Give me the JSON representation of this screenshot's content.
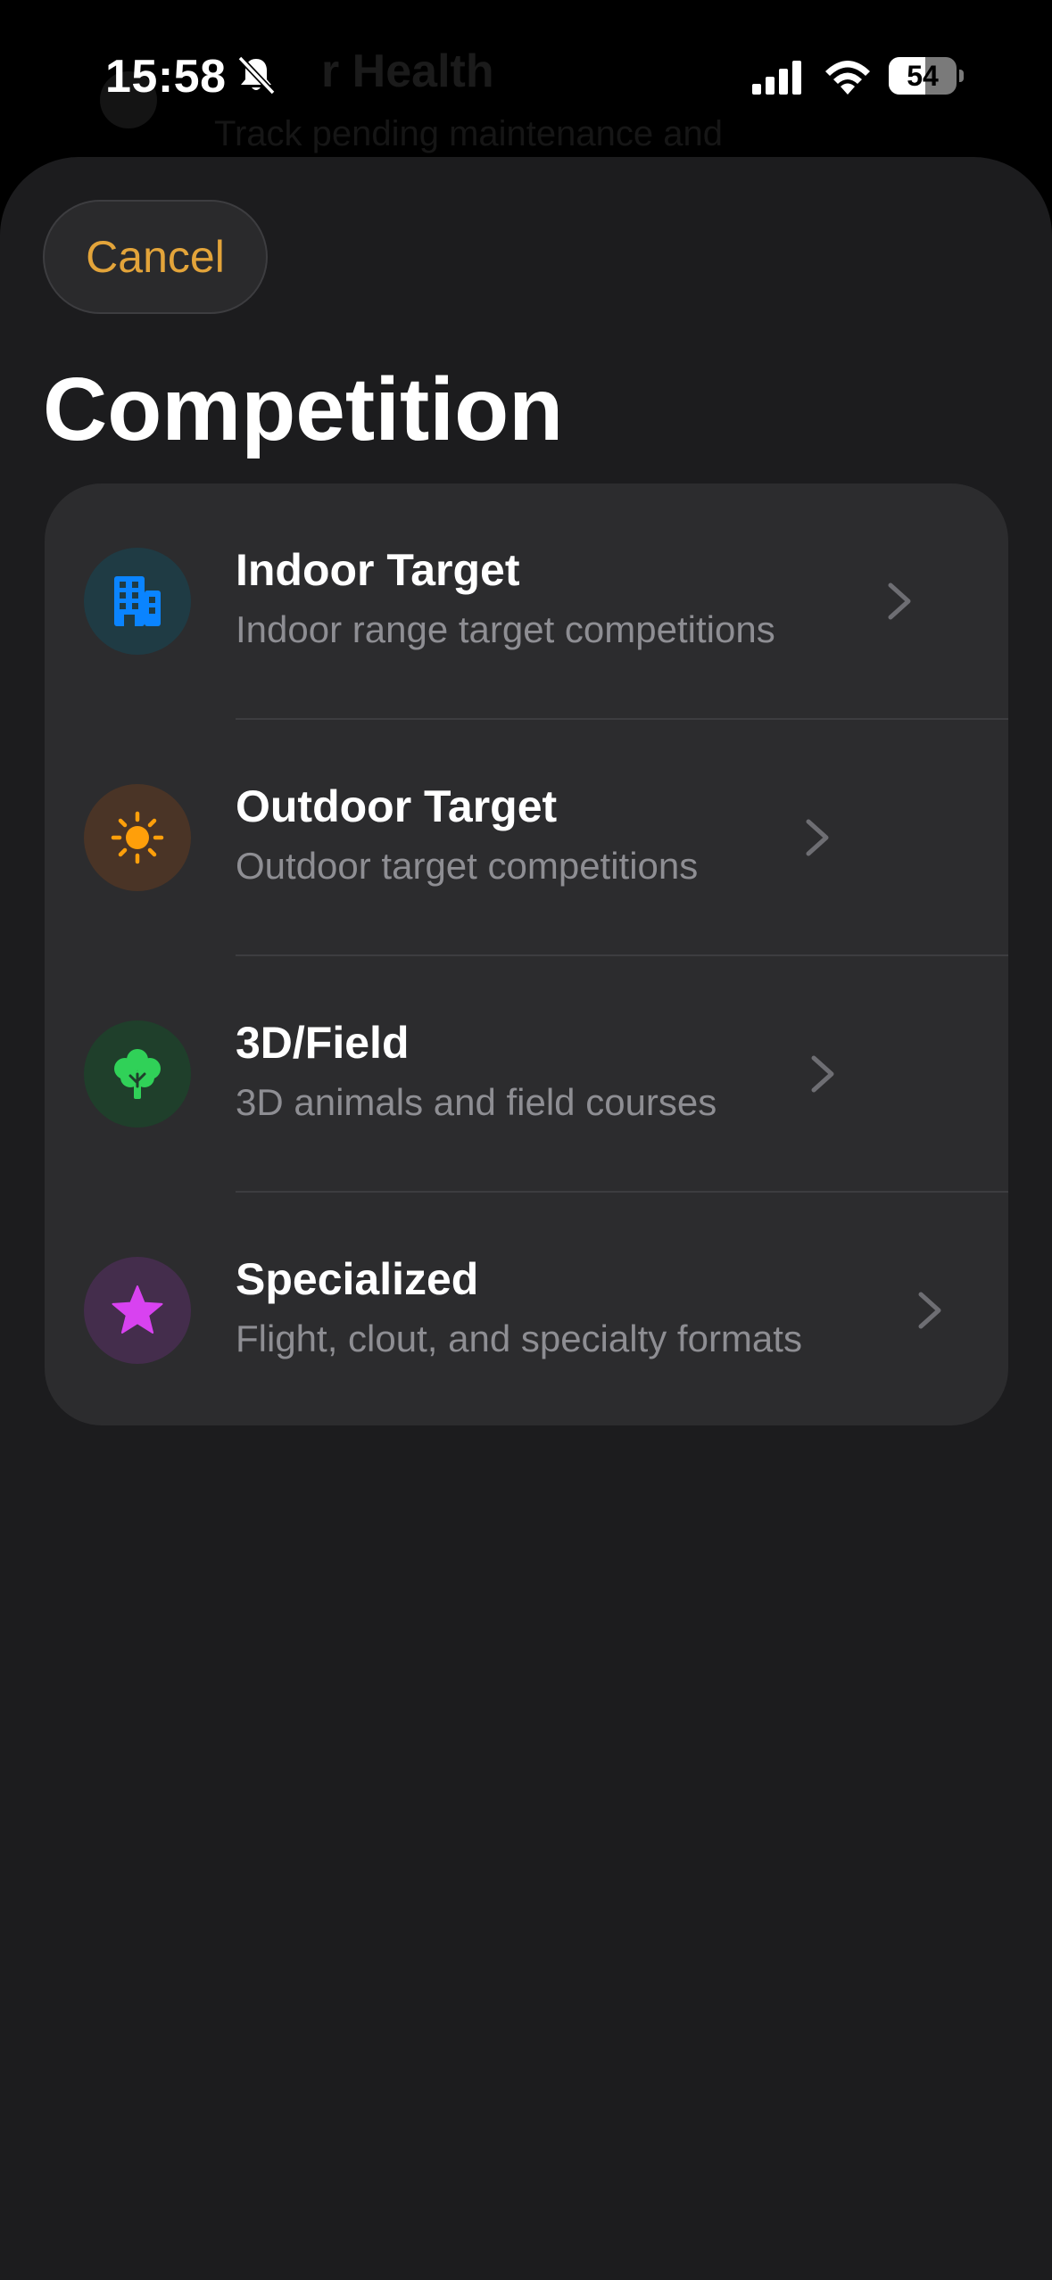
{
  "status_bar": {
    "time": "15:58",
    "battery_level": "54",
    "battery_fraction": 0.54
  },
  "background_screen": {
    "title": "r Health",
    "subtitle": "Track pending maintenance and"
  },
  "sheet": {
    "cancel_label": "Cancel",
    "title": "Competition",
    "accent_color": "#e3a43a",
    "items": [
      {
        "title": "Indoor Target",
        "subtitle": "Indoor range target competitions",
        "icon": "building-icon",
        "icon_color": "#0a84ff",
        "icon_bg": "#1f3b44"
      },
      {
        "title": "Outdoor Target",
        "subtitle": "Outdoor target competitions",
        "icon": "sun-icon",
        "icon_color": "#ff9f0a",
        "icon_bg": "#4a3426"
      },
      {
        "title": "3D/Field",
        "subtitle": "3D animals and field courses",
        "icon": "tree-icon",
        "icon_color": "#30d158",
        "icon_bg": "#1f3f2b"
      },
      {
        "title": "Specialized",
        "subtitle": "Flight, clout, and specialty formats",
        "icon": "star-icon",
        "icon_color": "#d842f0",
        "icon_bg": "#442d4c"
      }
    ]
  }
}
